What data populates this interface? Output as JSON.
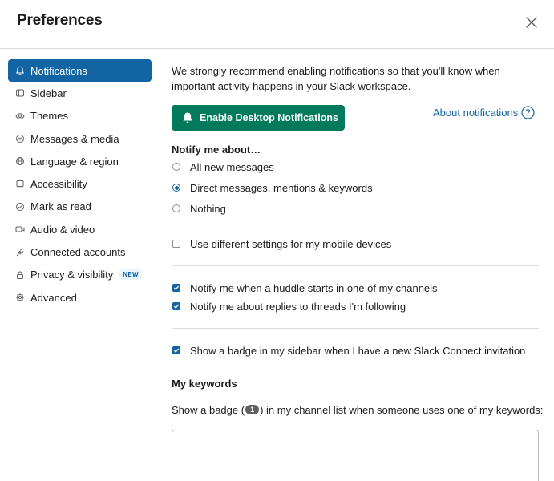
{
  "dialog": {
    "title": "Preferences"
  },
  "sidebar": {
    "items": [
      {
        "label": "Notifications",
        "icon": "bell-icon",
        "active": true
      },
      {
        "label": "Sidebar",
        "icon": "sidebar-icon"
      },
      {
        "label": "Themes",
        "icon": "eye-icon"
      },
      {
        "label": "Messages & media",
        "icon": "message-icon"
      },
      {
        "label": "Language & region",
        "icon": "globe-icon"
      },
      {
        "label": "Accessibility",
        "icon": "monitor-icon"
      },
      {
        "label": "Mark as read",
        "icon": "check-circle-icon"
      },
      {
        "label": "Audio & video",
        "icon": "video-icon"
      },
      {
        "label": "Connected accounts",
        "icon": "plug-icon"
      },
      {
        "label": "Privacy & visibility",
        "icon": "lock-icon",
        "badge": "NEW"
      },
      {
        "label": "Advanced",
        "icon": "gear-icon"
      }
    ]
  },
  "notifications": {
    "intro": "We strongly recommend enabling notifications so that you'll know when important activity happens in your Slack workspace.",
    "enable_button": "Enable Desktop Notifications",
    "about_link": "About notifications",
    "notify_heading": "Notify me about…",
    "options": [
      {
        "label": "All new messages",
        "checked": false
      },
      {
        "label": "Direct messages, mentions & keywords",
        "checked": true
      },
      {
        "label": "Nothing",
        "checked": false
      }
    ],
    "mobile_label": "Use different settings for my mobile devices",
    "mobile_checked": false,
    "huddle_label": "Notify me when a huddle starts in one of my channels",
    "huddle_checked": true,
    "threads_label": "Notify me about replies to threads I'm following",
    "threads_checked": true,
    "connect_label": "Show a badge in my sidebar when I have a new Slack Connect invitation",
    "connect_checked": true,
    "keywords_heading": "My keywords",
    "keywords_desc_before": "Show a badge (",
    "keywords_badge": "1",
    "keywords_desc_after": ") in my channel list when someone uses one of my keywords:",
    "keywords_value": ""
  },
  "colors": {
    "accent": "#1264a3",
    "primary_button": "#007a5a"
  }
}
